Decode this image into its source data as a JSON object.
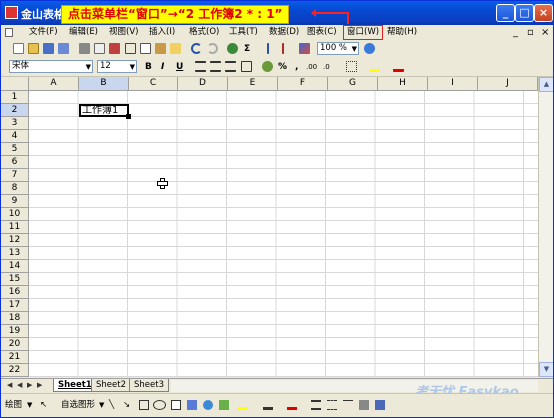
{
  "window": {
    "title": "金山表格",
    "hint": "点击菜单栏“窗口”→“2 工作簿2 * : 1”",
    "buttons": {
      "minimize": "_",
      "maximize": "□",
      "close": "×"
    }
  },
  "menubar": {
    "items": [
      "文件(F)",
      "编辑(E)",
      "视图(V)",
      "插入(I)",
      "格式(O)",
      "工具(T)",
      "数据(D)",
      "图表(C)",
      "窗口(W)",
      "帮助(H)"
    ],
    "active_item": "窗口(W)",
    "doc_controls": [
      "_",
      "▫",
      "×"
    ]
  },
  "toolbar": {
    "sigma": "Σ",
    "zoom": "100 %",
    "bold": "B",
    "italic": "I",
    "underline": "U",
    "percent": "%",
    "comma": ",",
    "inc_decimal": ".00",
    "dec_decimal": ".0"
  },
  "format_bar": {
    "font_name": "宋体",
    "font_size": "12"
  },
  "grid": {
    "columns": [
      "A",
      "B",
      "C",
      "D",
      "E",
      "F",
      "G",
      "H",
      "I",
      "J"
    ],
    "rows": [
      "1",
      "2",
      "3",
      "4",
      "5",
      "6",
      "7",
      "8",
      "9",
      "10",
      "11",
      "12",
      "13",
      "14",
      "15",
      "16",
      "17",
      "18",
      "19",
      "20",
      "21",
      "22"
    ],
    "selected_column": "B",
    "selected_row": "2",
    "active_cell_value": "工作簿1"
  },
  "sheets": {
    "tabs": [
      "Sheet1",
      "Sheet2",
      "Sheet3"
    ],
    "active": "Sheet1"
  },
  "watermark": "考无忧 Easykao",
  "drawbar": {
    "draw_label": "绘图",
    "autoshape_label": "自选图形"
  },
  "colors": {
    "title_bar": "#0a5ce8",
    "hint_bg": "#ffff00",
    "hint_text": "#e00000",
    "highlight": "#e0201a"
  }
}
